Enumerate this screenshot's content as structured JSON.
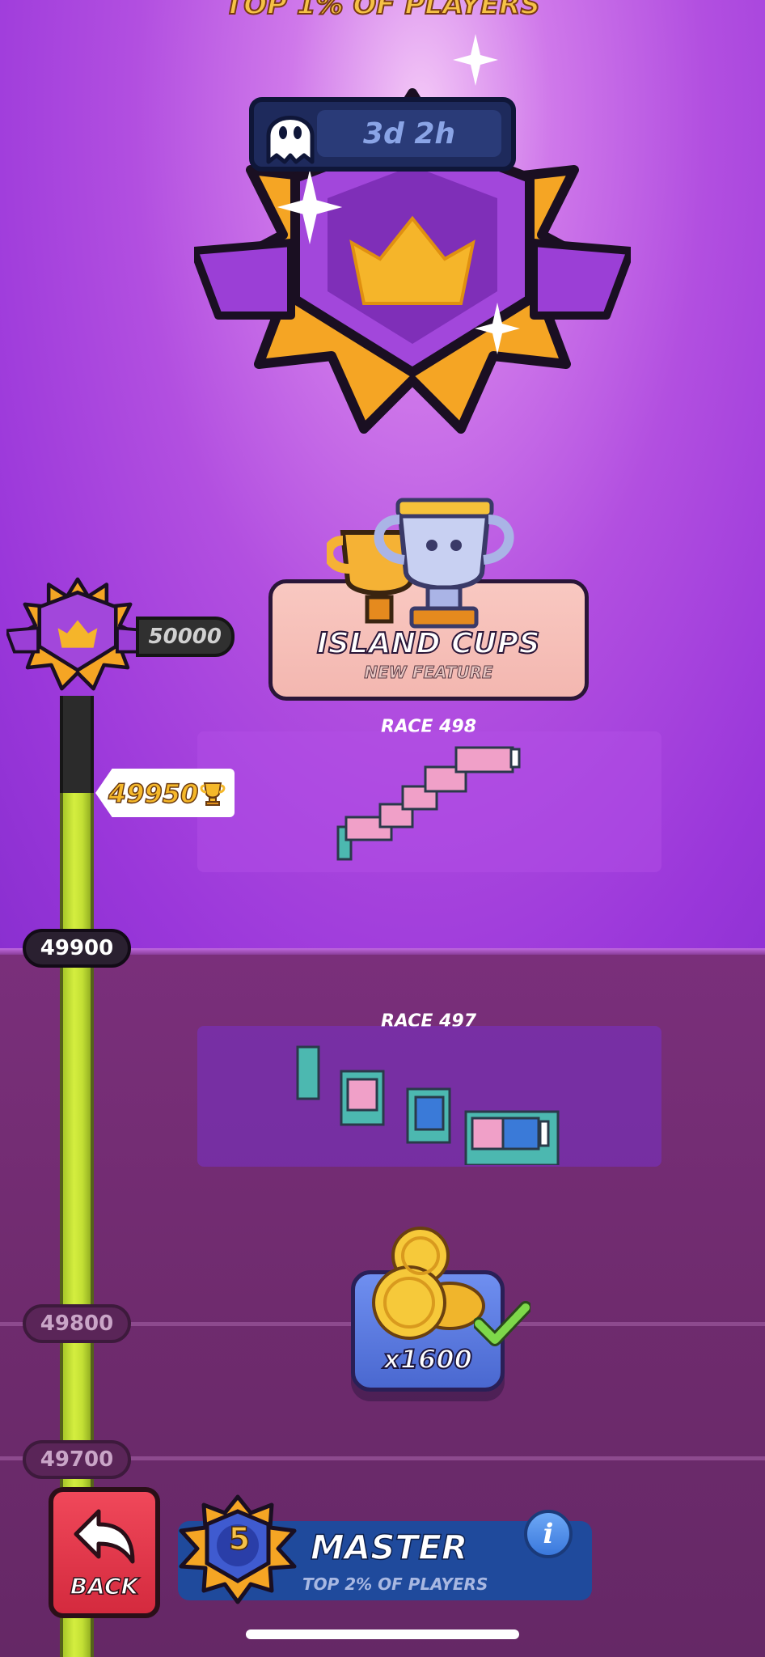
{
  "header": {
    "top_text": "TOP 1% OF PLAYERS"
  },
  "timer": {
    "value": "3d 2h",
    "icon": "ghost-icon"
  },
  "featured_badge": {
    "icon": "crown-icon",
    "colors": {
      "gold": "#f5a524",
      "purple": "#9a3fd4"
    }
  },
  "island_cups": {
    "title": "ISLAND CUPS",
    "subtitle": "NEW FEATURE"
  },
  "races": [
    {
      "label": "RACE 498"
    },
    {
      "label": "RACE 497"
    }
  ],
  "progress": {
    "milestone_top": "50000",
    "current_score": "49950",
    "current_icon": "trophy-icon",
    "markers": [
      "49900",
      "49800",
      "49700"
    ],
    "fill_color": "#cde33a"
  },
  "reward": {
    "amount": "x1600",
    "icon": "coins-icon",
    "claimed": true
  },
  "bottom_bar": {
    "back_label": "BACK",
    "rank_level": "5",
    "rank_name": "MASTER",
    "rank_sub": "TOP 2% OF PLAYERS",
    "info_label": "i"
  }
}
